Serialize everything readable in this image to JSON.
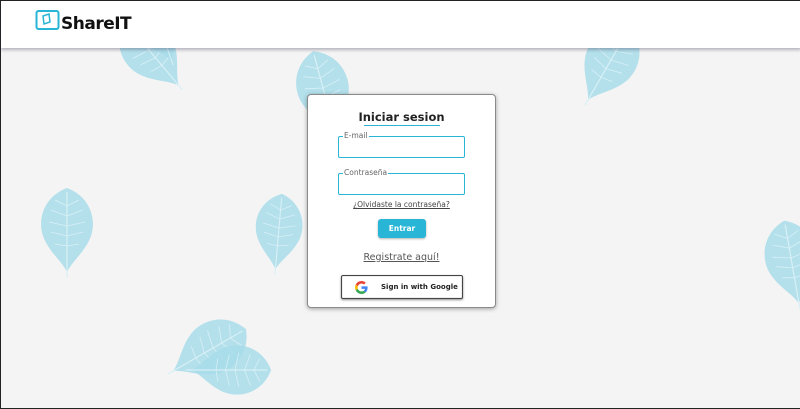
{
  "header": {
    "brand_name": "ShareIT",
    "logo_icon": "shareit-logo-icon"
  },
  "login": {
    "title": "Iniciar sesion",
    "email_label": "E-mail",
    "email_value": "",
    "password_label": "Contraseña",
    "password_value": "",
    "forgot_link": "¿Olvidaste la contraseña?",
    "submit_label": "Entrar",
    "register_link": "Registrate aquí!",
    "google_label": "Sign in with Google",
    "google_icon": "google-icon"
  },
  "colors": {
    "accent": "#29b6d6",
    "leaf": "#a8dcea",
    "background": "#f4f4f4"
  }
}
